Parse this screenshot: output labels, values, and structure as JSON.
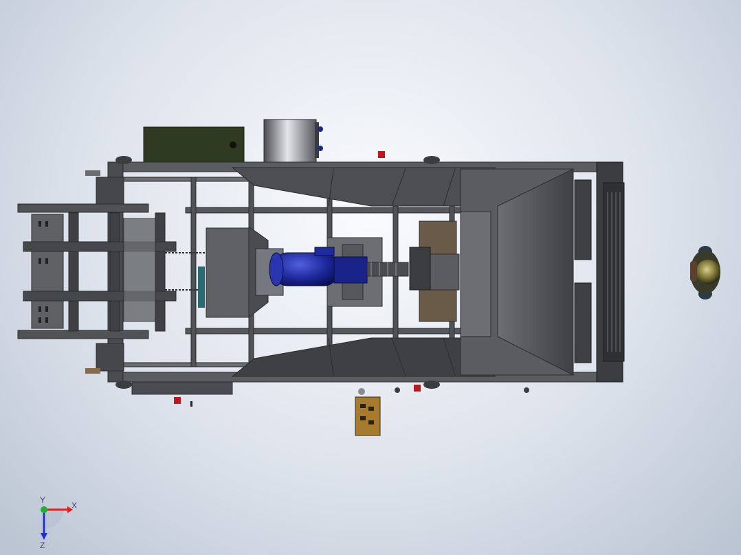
{
  "viewport": {
    "background_center": "#fafbfd",
    "background_edge": "#b9c3d1"
  },
  "colors": {
    "frame": "#5a5c60",
    "frame_dark": "#3a3c40",
    "sheet_metal": "#6b6d71",
    "hopper": "#4c4e52",
    "motor": "#1f2a9c",
    "control_box": "#2f3a22",
    "wood_plate": "#6a5a48",
    "label_box": "#a67c2c",
    "indicator_red": "#c0161c"
  },
  "model": {
    "parts": [
      {
        "name": "main-frame",
        "icon": "frame-icon"
      },
      {
        "name": "infeed-conveyor",
        "icon": "conveyor-icon"
      },
      {
        "name": "drive-motor",
        "icon": "motor-icon"
      },
      {
        "name": "control-cabinet",
        "icon": "cabinet-icon"
      },
      {
        "name": "cylinder-tank",
        "icon": "tank-icon"
      },
      {
        "name": "discharge-hopper",
        "icon": "hopper-icon"
      },
      {
        "name": "outlet-grille",
        "icon": "grille-icon"
      },
      {
        "name": "electrical-box",
        "icon": "box-icon"
      },
      {
        "name": "human-figure",
        "icon": "person-icon"
      }
    ]
  },
  "triad": {
    "x_label": "X",
    "y_label": "Y",
    "z_label": "Z",
    "x_color": "#e02020",
    "y_color": "#20b030",
    "z_color": "#2030d0"
  }
}
